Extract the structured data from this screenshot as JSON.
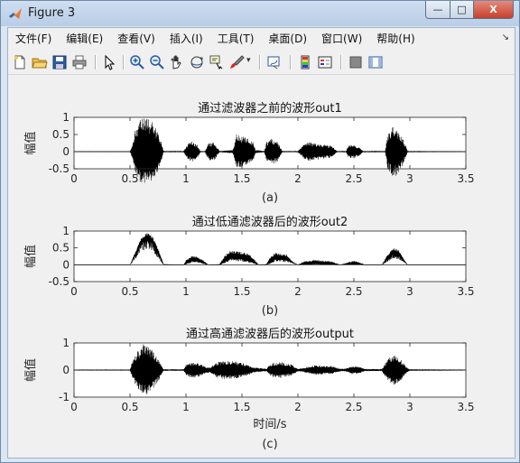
{
  "window": {
    "title": "Figure 3",
    "buttons": {
      "minimize": "—",
      "maximize": "□",
      "close": "X"
    }
  },
  "menubar": {
    "items": [
      "文件(F)",
      "编辑(E)",
      "查看(V)",
      "插入(I)",
      "工具(T)",
      "桌面(D)",
      "窗口(W)",
      "帮助(H)"
    ],
    "overflow": "↘"
  },
  "toolbar": {
    "icons": [
      "new-figure-icon",
      "open-file-icon",
      "save-icon",
      "print-icon",
      "pointer-icon",
      "zoom-in-icon",
      "zoom-out-icon",
      "pan-icon",
      "rotate-3d-icon",
      "data-cursor-icon",
      "brush-icon",
      "link-plot-icon",
      "colorbar-icon",
      "legend-icon",
      "hide-plot-tools-icon",
      "show-plot-tools-icon"
    ]
  },
  "colors": {
    "waveform": "#000000",
    "axes_bg": "#ffffff",
    "figure_bg": "#f0f0f0"
  },
  "chart_data": [
    {
      "type": "line",
      "title": "通过滤波器之前的波形out1",
      "ylabel": "幅值",
      "xlabel": "",
      "caption": "(a)",
      "xlim": [
        0,
        3.5
      ],
      "ylim": [
        -0.5,
        1
      ],
      "xticks": [
        "0",
        "0.5",
        "1",
        "1.5",
        "2",
        "2.5",
        "3",
        "3.5"
      ],
      "yticks": [
        "1",
        "0.5",
        "0",
        "-0.5"
      ],
      "series": [
        {
          "envelope": [
            {
              "x": 0.0,
              "y": 0.01
            },
            {
              "x": 0.5,
              "y": 0.01
            },
            {
              "x": 0.52,
              "y": 0.2
            },
            {
              "x": 0.55,
              "y": 0.7
            },
            {
              "x": 0.6,
              "y": 0.95
            },
            {
              "x": 0.65,
              "y": 1.0
            },
            {
              "x": 0.7,
              "y": 0.9
            },
            {
              "x": 0.76,
              "y": 0.5
            },
            {
              "x": 0.8,
              "y": 0.02
            },
            {
              "x": 0.98,
              "y": 0.02
            },
            {
              "x": 1.02,
              "y": 0.25
            },
            {
              "x": 1.05,
              "y": 0.3
            },
            {
              "x": 1.1,
              "y": 0.2
            },
            {
              "x": 1.13,
              "y": 0.02
            },
            {
              "x": 1.17,
              "y": 0.02
            },
            {
              "x": 1.2,
              "y": 0.25
            },
            {
              "x": 1.25,
              "y": 0.28
            },
            {
              "x": 1.3,
              "y": 0.02
            },
            {
              "x": 1.42,
              "y": 0.05
            },
            {
              "x": 1.45,
              "y": 0.5
            },
            {
              "x": 1.5,
              "y": 0.45
            },
            {
              "x": 1.55,
              "y": 0.4
            },
            {
              "x": 1.6,
              "y": 0.3
            },
            {
              "x": 1.62,
              "y": 0.05
            },
            {
              "x": 1.7,
              "y": 0.02
            },
            {
              "x": 1.72,
              "y": 0.3
            },
            {
              "x": 1.77,
              "y": 0.38
            },
            {
              "x": 1.82,
              "y": 0.3
            },
            {
              "x": 1.86,
              "y": 0.02
            },
            {
              "x": 2.0,
              "y": 0.02
            },
            {
              "x": 2.05,
              "y": 0.2
            },
            {
              "x": 2.1,
              "y": 0.28
            },
            {
              "x": 2.2,
              "y": 0.22
            },
            {
              "x": 2.3,
              "y": 0.18
            },
            {
              "x": 2.35,
              "y": 0.02
            },
            {
              "x": 2.43,
              "y": 0.02
            },
            {
              "x": 2.45,
              "y": 0.18
            },
            {
              "x": 2.5,
              "y": 0.2
            },
            {
              "x": 2.55,
              "y": 0.12
            },
            {
              "x": 2.58,
              "y": 0.02
            },
            {
              "x": 2.78,
              "y": 0.02
            },
            {
              "x": 2.8,
              "y": 0.5
            },
            {
              "x": 2.85,
              "y": 0.75
            },
            {
              "x": 2.9,
              "y": 0.65
            },
            {
              "x": 2.95,
              "y": 0.3
            },
            {
              "x": 2.98,
              "y": 0.02
            },
            {
              "x": 3.5,
              "y": 0.01
            }
          ]
        }
      ]
    },
    {
      "type": "line",
      "title": "通过低通滤波器后的波形out2",
      "ylabel": "幅值",
      "xlabel": "",
      "caption": "(b)",
      "xlim": [
        0,
        3.5
      ],
      "ylim": [
        -0.5,
        1
      ],
      "xticks": [
        "0",
        "0.5",
        "1",
        "1.5",
        "2",
        "2.5",
        "3",
        "3.5"
      ],
      "yticks": [
        "1",
        "0.5",
        "0",
        "-0.5"
      ],
      "series": [
        {
          "upper": [
            {
              "x": 0.0,
              "y": 0.0
            },
            {
              "x": 0.5,
              "y": 0.0
            },
            {
              "x": 0.55,
              "y": 0.4
            },
            {
              "x": 0.6,
              "y": 0.8
            },
            {
              "x": 0.65,
              "y": 0.95
            },
            {
              "x": 0.7,
              "y": 0.85
            },
            {
              "x": 0.75,
              "y": 0.5
            },
            {
              "x": 0.8,
              "y": 0.02
            },
            {
              "x": 0.98,
              "y": 0.0
            },
            {
              "x": 1.0,
              "y": 0.15
            },
            {
              "x": 1.05,
              "y": 0.25
            },
            {
              "x": 1.1,
              "y": 0.25
            },
            {
              "x": 1.15,
              "y": 0.15
            },
            {
              "x": 1.2,
              "y": 0.0
            },
            {
              "x": 1.3,
              "y": 0.02
            },
            {
              "x": 1.35,
              "y": 0.3
            },
            {
              "x": 1.4,
              "y": 0.42
            },
            {
              "x": 1.5,
              "y": 0.38
            },
            {
              "x": 1.55,
              "y": 0.35
            },
            {
              "x": 1.6,
              "y": 0.2
            },
            {
              "x": 1.65,
              "y": 0.0
            },
            {
              "x": 1.72,
              "y": 0.02
            },
            {
              "x": 1.75,
              "y": 0.25
            },
            {
              "x": 1.8,
              "y": 0.35
            },
            {
              "x": 1.9,
              "y": 0.3
            },
            {
              "x": 1.95,
              "y": 0.1
            },
            {
              "x": 2.0,
              "y": 0.0
            },
            {
              "x": 2.05,
              "y": 0.1
            },
            {
              "x": 2.15,
              "y": 0.15
            },
            {
              "x": 2.3,
              "y": 0.1
            },
            {
              "x": 2.38,
              "y": 0.0
            },
            {
              "x": 2.42,
              "y": 0.05
            },
            {
              "x": 2.5,
              "y": 0.12
            },
            {
              "x": 2.55,
              "y": 0.08
            },
            {
              "x": 2.6,
              "y": 0.0
            },
            {
              "x": 2.75,
              "y": 0.0
            },
            {
              "x": 2.8,
              "y": 0.3
            },
            {
              "x": 2.85,
              "y": 0.5
            },
            {
              "x": 2.9,
              "y": 0.45
            },
            {
              "x": 2.95,
              "y": 0.15
            },
            {
              "x": 2.98,
              "y": 0.0
            },
            {
              "x": 3.5,
              "y": 0.0
            }
          ]
        },
        {
          "lower": [
            {
              "x": 0.0,
              "y": 0.0
            },
            {
              "x": 0.5,
              "y": 0.0
            },
            {
              "x": 0.55,
              "y": 0.3
            },
            {
              "x": 0.6,
              "y": 0.65
            },
            {
              "x": 0.65,
              "y": 0.75
            },
            {
              "x": 0.7,
              "y": 0.65
            },
            {
              "x": 0.75,
              "y": 0.35
            },
            {
              "x": 0.8,
              "y": 0.0
            },
            {
              "x": 0.98,
              "y": 0.0
            },
            {
              "x": 1.05,
              "y": 0.12
            },
            {
              "x": 1.1,
              "y": 0.12
            },
            {
              "x": 1.2,
              "y": 0.0
            },
            {
              "x": 1.3,
              "y": 0.0
            },
            {
              "x": 1.4,
              "y": 0.2
            },
            {
              "x": 1.5,
              "y": 0.18
            },
            {
              "x": 1.6,
              "y": 0.08
            },
            {
              "x": 1.65,
              "y": 0.0
            },
            {
              "x": 1.72,
              "y": 0.0
            },
            {
              "x": 1.8,
              "y": 0.18
            },
            {
              "x": 1.9,
              "y": 0.15
            },
            {
              "x": 2.0,
              "y": 0.0
            },
            {
              "x": 2.15,
              "y": 0.03
            },
            {
              "x": 2.38,
              "y": 0.0
            },
            {
              "x": 2.5,
              "y": 0.02
            },
            {
              "x": 2.6,
              "y": 0.0
            },
            {
              "x": 2.75,
              "y": 0.0
            },
            {
              "x": 2.85,
              "y": 0.32
            },
            {
              "x": 2.9,
              "y": 0.28
            },
            {
              "x": 2.98,
              "y": 0.0
            },
            {
              "x": 3.5,
              "y": 0.0
            }
          ]
        }
      ]
    },
    {
      "type": "line",
      "title": "通过高通滤波器后的波形output",
      "ylabel": "幅值",
      "xlabel": "时间/s",
      "caption": "(c)",
      "xlim": [
        0,
        3.5
      ],
      "ylim": [
        -1,
        1
      ],
      "xticks": [
        "0",
        "0.5",
        "1",
        "1.5",
        "2",
        "2.5",
        "3",
        "3.5"
      ],
      "yticks": [
        "1",
        "0",
        "-1"
      ],
      "series": [
        {
          "envelope": [
            {
              "x": 0.0,
              "y": 0.02
            },
            {
              "x": 0.5,
              "y": 0.02
            },
            {
              "x": 0.52,
              "y": 0.3
            },
            {
              "x": 0.56,
              "y": 0.65
            },
            {
              "x": 0.62,
              "y": 0.95
            },
            {
              "x": 0.66,
              "y": 0.9
            },
            {
              "x": 0.7,
              "y": 0.75
            },
            {
              "x": 0.76,
              "y": 0.35
            },
            {
              "x": 0.8,
              "y": 0.03
            },
            {
              "x": 0.98,
              "y": 0.03
            },
            {
              "x": 1.0,
              "y": 0.2
            },
            {
              "x": 1.05,
              "y": 0.3
            },
            {
              "x": 1.12,
              "y": 0.25
            },
            {
              "x": 1.18,
              "y": 0.1
            },
            {
              "x": 1.22,
              "y": 0.1
            },
            {
              "x": 1.28,
              "y": 0.3
            },
            {
              "x": 1.38,
              "y": 0.35
            },
            {
              "x": 1.5,
              "y": 0.28
            },
            {
              "x": 1.6,
              "y": 0.1
            },
            {
              "x": 1.72,
              "y": 0.05
            },
            {
              "x": 1.76,
              "y": 0.25
            },
            {
              "x": 1.85,
              "y": 0.3
            },
            {
              "x": 1.95,
              "y": 0.2
            },
            {
              "x": 2.0,
              "y": 0.05
            },
            {
              "x": 2.05,
              "y": 0.08
            },
            {
              "x": 2.15,
              "y": 0.18
            },
            {
              "x": 2.3,
              "y": 0.15
            },
            {
              "x": 2.38,
              "y": 0.05
            },
            {
              "x": 2.42,
              "y": 0.05
            },
            {
              "x": 2.48,
              "y": 0.15
            },
            {
              "x": 2.55,
              "y": 0.12
            },
            {
              "x": 2.6,
              "y": 0.04
            },
            {
              "x": 2.75,
              "y": 0.04
            },
            {
              "x": 2.8,
              "y": 0.4
            },
            {
              "x": 2.85,
              "y": 0.58
            },
            {
              "x": 2.9,
              "y": 0.5
            },
            {
              "x": 2.97,
              "y": 0.1
            },
            {
              "x": 3.0,
              "y": 0.03
            },
            {
              "x": 3.5,
              "y": 0.02
            }
          ]
        }
      ]
    }
  ]
}
